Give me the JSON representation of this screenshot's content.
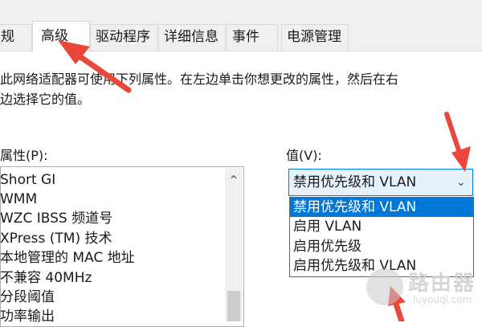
{
  "tabs": [
    {
      "label": "规",
      "active": false
    },
    {
      "label": "高级",
      "active": true
    },
    {
      "label": "驱动程序",
      "active": false
    },
    {
      "label": "详细信息",
      "active": false
    },
    {
      "label": "事件",
      "active": false
    },
    {
      "label": "电源管理",
      "active": false
    }
  ],
  "description": {
    "line1": "此网络适配器可使用下列属性。在左边单击你想更改的属性，然后在右",
    "line2": "边选择它的值。"
  },
  "properties": {
    "label": "属性(P):",
    "items": [
      "Short GI",
      "WMM",
      "WZC IBSS 频道号",
      "XPress (TM) 技术",
      "本地管理的 MAC 地址",
      "不兼容 40MHz",
      "分段阈值",
      "功率输出"
    ]
  },
  "value": {
    "label": "值(V):",
    "selected": "禁用优先级和 VLAN",
    "options": [
      "禁用优先级和 VLAN",
      "启用 VLAN",
      "启用优先级",
      "启用优先级和 VLAN"
    ]
  },
  "colors": {
    "annotation_arrow": "#e8473a",
    "selection": "#0078d7"
  },
  "icons": {
    "dropdown": "chevron-down-icon",
    "scroll_up": "chevron-up-icon"
  },
  "watermark": {
    "text": "路由器",
    "url": "luyouqi.com"
  }
}
